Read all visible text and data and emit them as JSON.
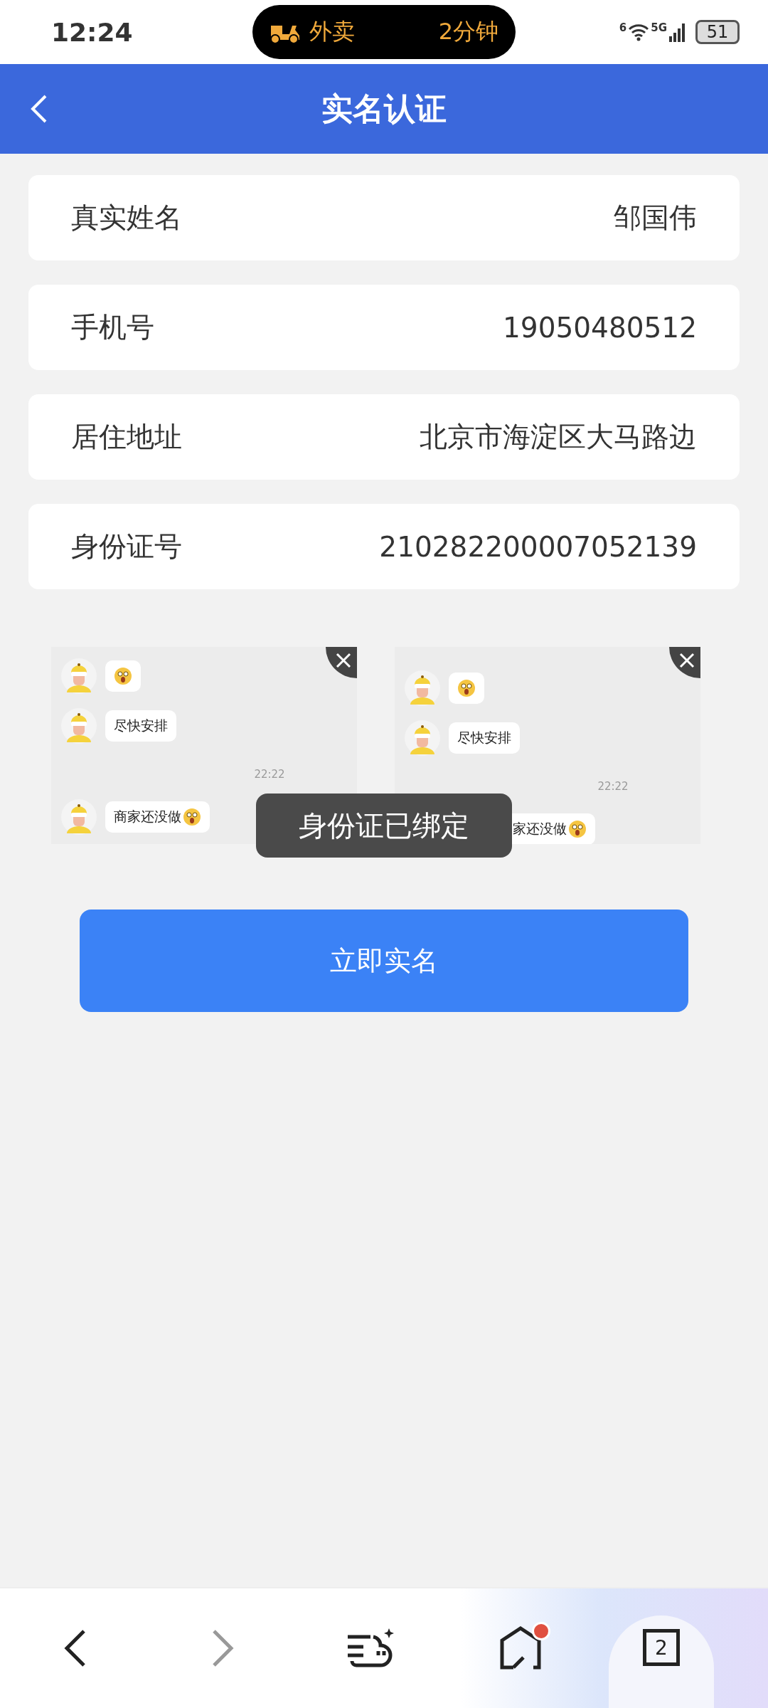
{
  "status_bar": {
    "time": "12:24",
    "activity": {
      "label": "外卖",
      "eta": "2分钟"
    },
    "wifi_badge": "6",
    "network": "5G",
    "battery": "51"
  },
  "header": {
    "title": "实名认证"
  },
  "fields": [
    {
      "label": "真实姓名",
      "value": "邹国伟"
    },
    {
      "label": "手机号",
      "value": "19050480512"
    },
    {
      "label": "居住地址",
      "value": "北京市海淀区大马路边"
    },
    {
      "label": "身份证号",
      "value": "210282200007052139"
    }
  ],
  "screenshots": [
    {
      "offset": false,
      "messages": [
        {
          "kind": "emoji"
        },
        {
          "kind": "text",
          "text": "尽快安排"
        },
        {
          "kind": "time",
          "text": "22:22"
        },
        {
          "kind": "text_emoji",
          "text": "商家还没做"
        }
      ]
    },
    {
      "offset": true,
      "messages": [
        {
          "kind": "emoji"
        },
        {
          "kind": "text",
          "text": "尽快安排"
        },
        {
          "kind": "time",
          "text": "22:22"
        },
        {
          "kind": "text_emoji",
          "text": "家还没做"
        }
      ]
    }
  ],
  "toast": "身份证已绑定",
  "submit_button": "立即实名",
  "bottom_nav": [
    {
      "kind": "back",
      "disabled": false
    },
    {
      "kind": "forward",
      "disabled": true
    },
    {
      "kind": "assistant",
      "disabled": false
    },
    {
      "kind": "home",
      "disabled": false,
      "notification": true
    },
    {
      "kind": "tabs",
      "disabled": false,
      "count": "2"
    }
  ]
}
